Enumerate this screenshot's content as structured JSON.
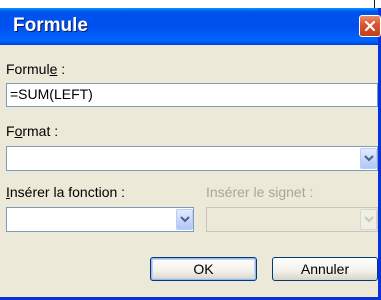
{
  "dialog": {
    "title": "Formule",
    "close_icon": "close-x-icon"
  },
  "formula": {
    "label_pre": "Formul",
    "label_accel": "e",
    "label_post": " :",
    "value": "=SUM(LEFT)"
  },
  "format": {
    "label_pre": "F",
    "label_accel": "o",
    "label_post": "rmat :",
    "value": ""
  },
  "function": {
    "label_accel": "I",
    "label_post": "nsérer la fonction :",
    "value": ""
  },
  "bookmark": {
    "label": "Insérer le signet :",
    "value": ""
  },
  "buttons": {
    "ok": "OK",
    "cancel": "Annuler"
  },
  "colors": {
    "titlebar": "#0053ee",
    "dialog_bg": "#ece9d8",
    "close_button": "#d9532b"
  }
}
